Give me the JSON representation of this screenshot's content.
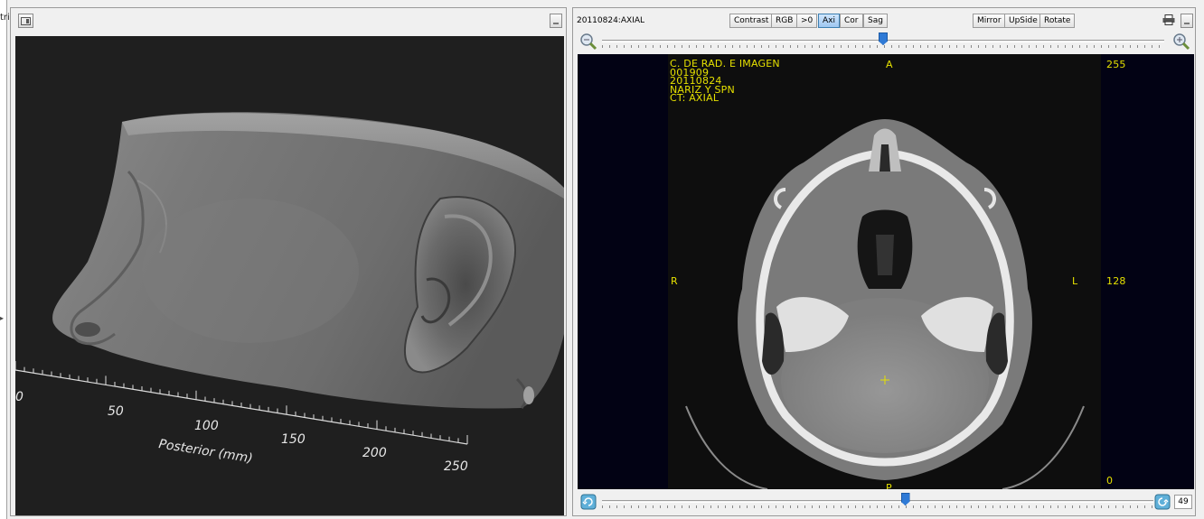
{
  "left_strip": {
    "fragment": "tri",
    "arrow": "▸"
  },
  "left_panel": {
    "ruler": {
      "tick_labels": [
        "0",
        "50",
        "100",
        "150",
        "200",
        "250"
      ],
      "axis_label": "Posterior (mm)"
    }
  },
  "right_panel": {
    "series_label": "20110824:AXIAL",
    "buttons": {
      "contrast": "Contrast",
      "rgb": "RGB",
      "gt0": ">0",
      "axi": "Axi",
      "cor": "Cor",
      "sag": "Sag",
      "mirror": "Mirror",
      "upside": "UpSide",
      "rotate": "Rotate"
    },
    "zoom_slider_value": 0.5,
    "slice_slider_value": 0.55,
    "slice_number": "49",
    "overlay": {
      "info_lines": [
        "C. DE RAD. E IMAGEN",
        "001909",
        "20110824",
        "NARIZ Y SPN",
        "CT: AXIAL"
      ],
      "orientation_top": "A",
      "orientation_left": "R",
      "orientation_right": "L",
      "orientation_bottom": "P",
      "scale_max": "255",
      "scale_mid": "128",
      "scale_min": "0"
    }
  },
  "colors": {
    "overlay": "#e5e000",
    "slider_thumb": "#2f7ad6",
    "active_button": "#9ec7f0"
  }
}
